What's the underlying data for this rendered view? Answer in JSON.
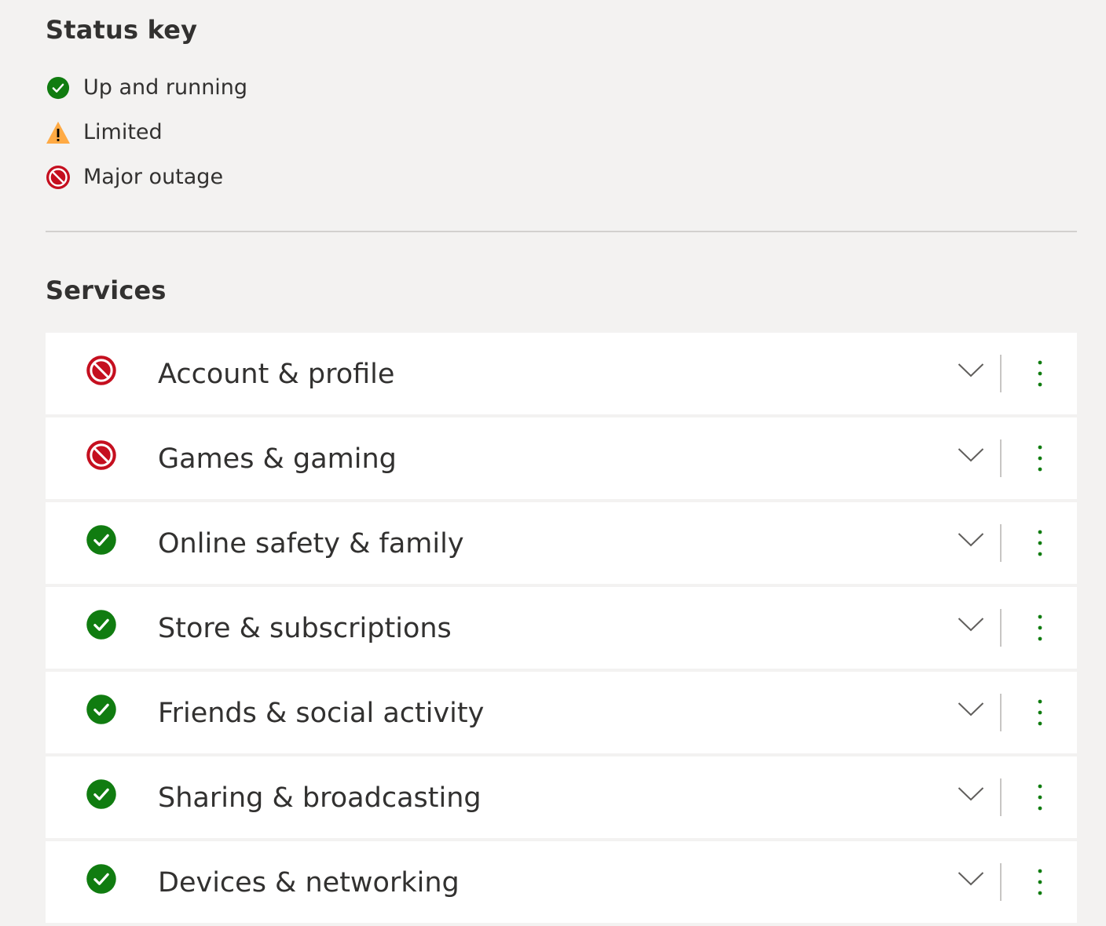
{
  "status_key": {
    "title": "Status key",
    "items": [
      {
        "label": "Up and running",
        "icon": "check-circle-icon",
        "color": "#107c10"
      },
      {
        "label": "Limited",
        "icon": "warning-triangle-icon",
        "color": "#ffaa44"
      },
      {
        "label": "Major outage",
        "icon": "blocked-circle-icon",
        "color": "#c50f1f"
      }
    ]
  },
  "services": {
    "title": "Services",
    "items": [
      {
        "name": "Account & profile",
        "status": "Major outage",
        "icon": "blocked-circle-icon"
      },
      {
        "name": "Games & gaming",
        "status": "Major outage",
        "icon": "blocked-circle-icon"
      },
      {
        "name": "Online safety & family",
        "status": "Up and running",
        "icon": "check-circle-icon"
      },
      {
        "name": "Store & subscriptions",
        "status": "Up and running",
        "icon": "check-circle-icon"
      },
      {
        "name": "Friends & social activity",
        "status": "Up and running",
        "icon": "check-circle-icon"
      },
      {
        "name": "Sharing & broadcasting",
        "status": "Up and running",
        "icon": "check-circle-icon"
      },
      {
        "name": "Devices & networking",
        "status": "Up and running",
        "icon": "check-circle-icon"
      }
    ]
  },
  "colors": {
    "background": "#f3f2f1",
    "card": "#ffffff",
    "text": "#323130",
    "ok": "#107c10",
    "warning": "#ffaa44",
    "outage": "#c50f1f",
    "more_dots": "#107c10"
  },
  "row_icons": {
    "expand": "chevron-down-icon",
    "more": "more-vertical-icon"
  }
}
